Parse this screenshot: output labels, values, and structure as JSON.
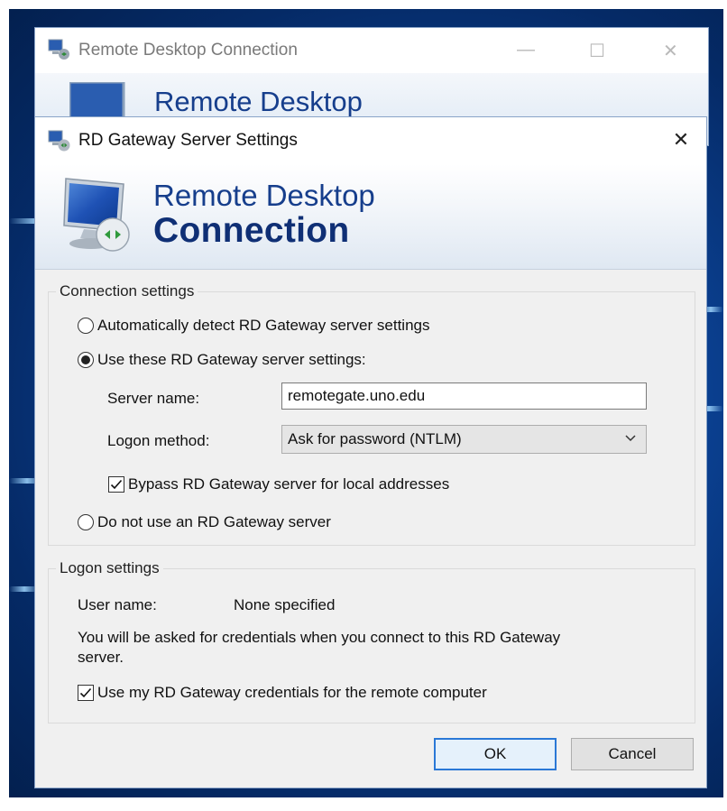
{
  "background_window": {
    "title": "Remote Desktop Connection",
    "banner_text": "Remote Desktop",
    "controls": {
      "minimize": "—",
      "maximize": "☐",
      "close": "✕"
    }
  },
  "dialog": {
    "title": "RD Gateway Server Settings",
    "close_glyph": "✕",
    "banner": {
      "line1": "Remote Desktop",
      "line2": "Connection"
    },
    "connection_settings": {
      "legend": "Connection settings",
      "option_auto": "Automatically detect RD Gateway server settings",
      "option_use": "Use these RD Gateway server settings:",
      "server_name_label": "Server name:",
      "server_name_value": "remotegate.uno.edu",
      "logon_method_label": "Logon method:",
      "logon_method_value": "Ask for password (NTLM)",
      "bypass_label": "Bypass RD Gateway server for local addresses",
      "option_none": "Do not use an RD Gateway server"
    },
    "logon_settings": {
      "legend": "Logon settings",
      "user_name_label": "User name:",
      "user_name_value": "None specified",
      "info_text_line1": "You will be asked for credentials when you connect to this RD Gateway",
      "info_text_line2": "server.",
      "use_credentials_label": "Use my RD Gateway credentials for the remote computer"
    },
    "buttons": {
      "ok": "OK",
      "cancel": "Cancel"
    }
  },
  "colors": {
    "accent": "#2a78d6",
    "banner_text": "#163e8c",
    "desktop": "#0a3f8f"
  }
}
